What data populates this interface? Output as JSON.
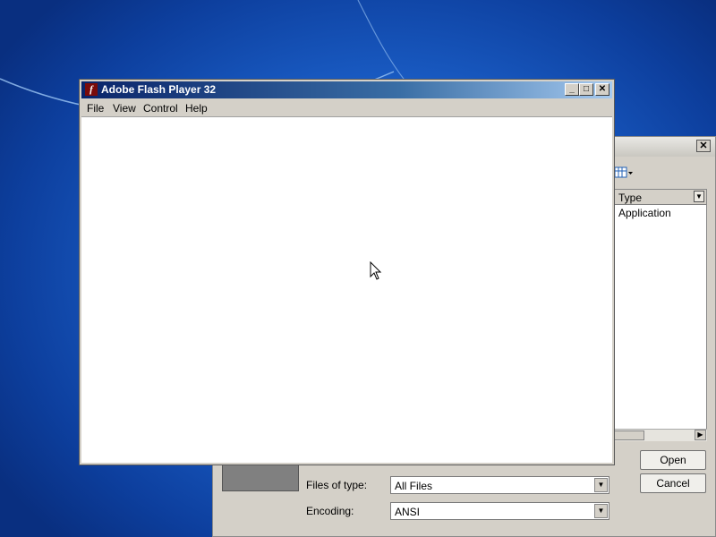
{
  "flash_window": {
    "title": "Adobe Flash Player 32",
    "menu": [
      "File",
      "View",
      "Control",
      "Help"
    ],
    "controls": {
      "minimize": "_",
      "maximize": "□",
      "close": "✕"
    }
  },
  "open_dialog": {
    "close_glyph": "✕",
    "column_header": "Type",
    "rows": [
      "Application"
    ],
    "files_of_type_label": "Files of type:",
    "files_of_type_value": "All Files",
    "encoding_label": "Encoding:",
    "encoding_value": "ANSI",
    "open_button": "Open",
    "cancel_button": "Cancel"
  },
  "colors": {
    "desktop": "#1b5fc8",
    "title_active": "#0a246a",
    "dialog_face": "#d4d0c8"
  }
}
